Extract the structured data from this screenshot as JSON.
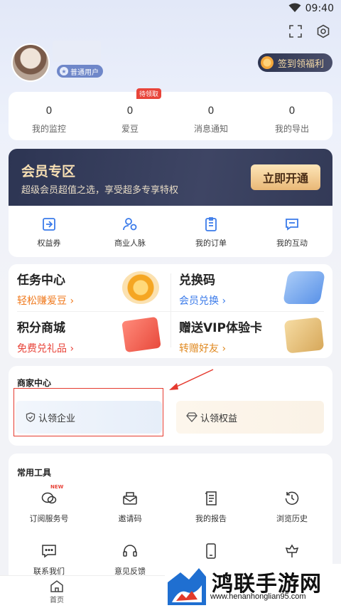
{
  "status_bar": {
    "time": "09:40"
  },
  "profile": {
    "badge": "普通用户",
    "checkin": "签到领福利"
  },
  "stats": [
    {
      "num": "0",
      "label": "我的监控"
    },
    {
      "num": "0",
      "label": "爱豆",
      "tag": "待领取"
    },
    {
      "num": "0",
      "label": "消息通知"
    },
    {
      "num": "0",
      "label": "我的导出"
    }
  ],
  "vip": {
    "title": "会员专区",
    "subtitle": "超级会员超值之选，享受超多专享特权",
    "button": "立即开通",
    "items": [
      {
        "label": "权益券",
        "icon": "coupon-icon"
      },
      {
        "label": "商业人脉",
        "icon": "contacts-icon"
      },
      {
        "label": "我的订单",
        "icon": "order-icon"
      },
      {
        "label": "我的互动",
        "icon": "chat-icon"
      }
    ]
  },
  "tasks": [
    {
      "title": "任务中心",
      "sub": "轻松赚爱豆",
      "color": "#f07a1e"
    },
    {
      "title": "兑换码",
      "sub": "会员兑换",
      "color": "#3b7bea"
    },
    {
      "title": "积分商城",
      "sub": "免费兑礼品",
      "color": "#e8443a"
    },
    {
      "title": "赠送VIP体验卡",
      "sub": "转赠好友",
      "color": "#e08a22"
    }
  ],
  "merchant": {
    "title": "商家中心",
    "claim_company": "认领企业",
    "claim_rights": "认领权益"
  },
  "tools": {
    "title": "常用工具",
    "new_tag": "NEW",
    "items": [
      {
        "label": "订阅服务号",
        "icon": "subscribe-icon"
      },
      {
        "label": "邀请码",
        "icon": "invite-icon"
      },
      {
        "label": "我的报告",
        "icon": "report-icon"
      },
      {
        "label": "浏览历史",
        "icon": "history-icon"
      },
      {
        "label": "联系我们",
        "icon": "message-icon"
      },
      {
        "label": "意见反馈",
        "icon": "headset-icon"
      },
      {
        "label": "",
        "icon": "phone-icon"
      },
      {
        "label": "",
        "icon": "flower-icon"
      }
    ]
  },
  "nav": {
    "home": "首页"
  },
  "watermark": {
    "name": "鸿联手游网",
    "url": "www.henanhonglian95.com"
  }
}
